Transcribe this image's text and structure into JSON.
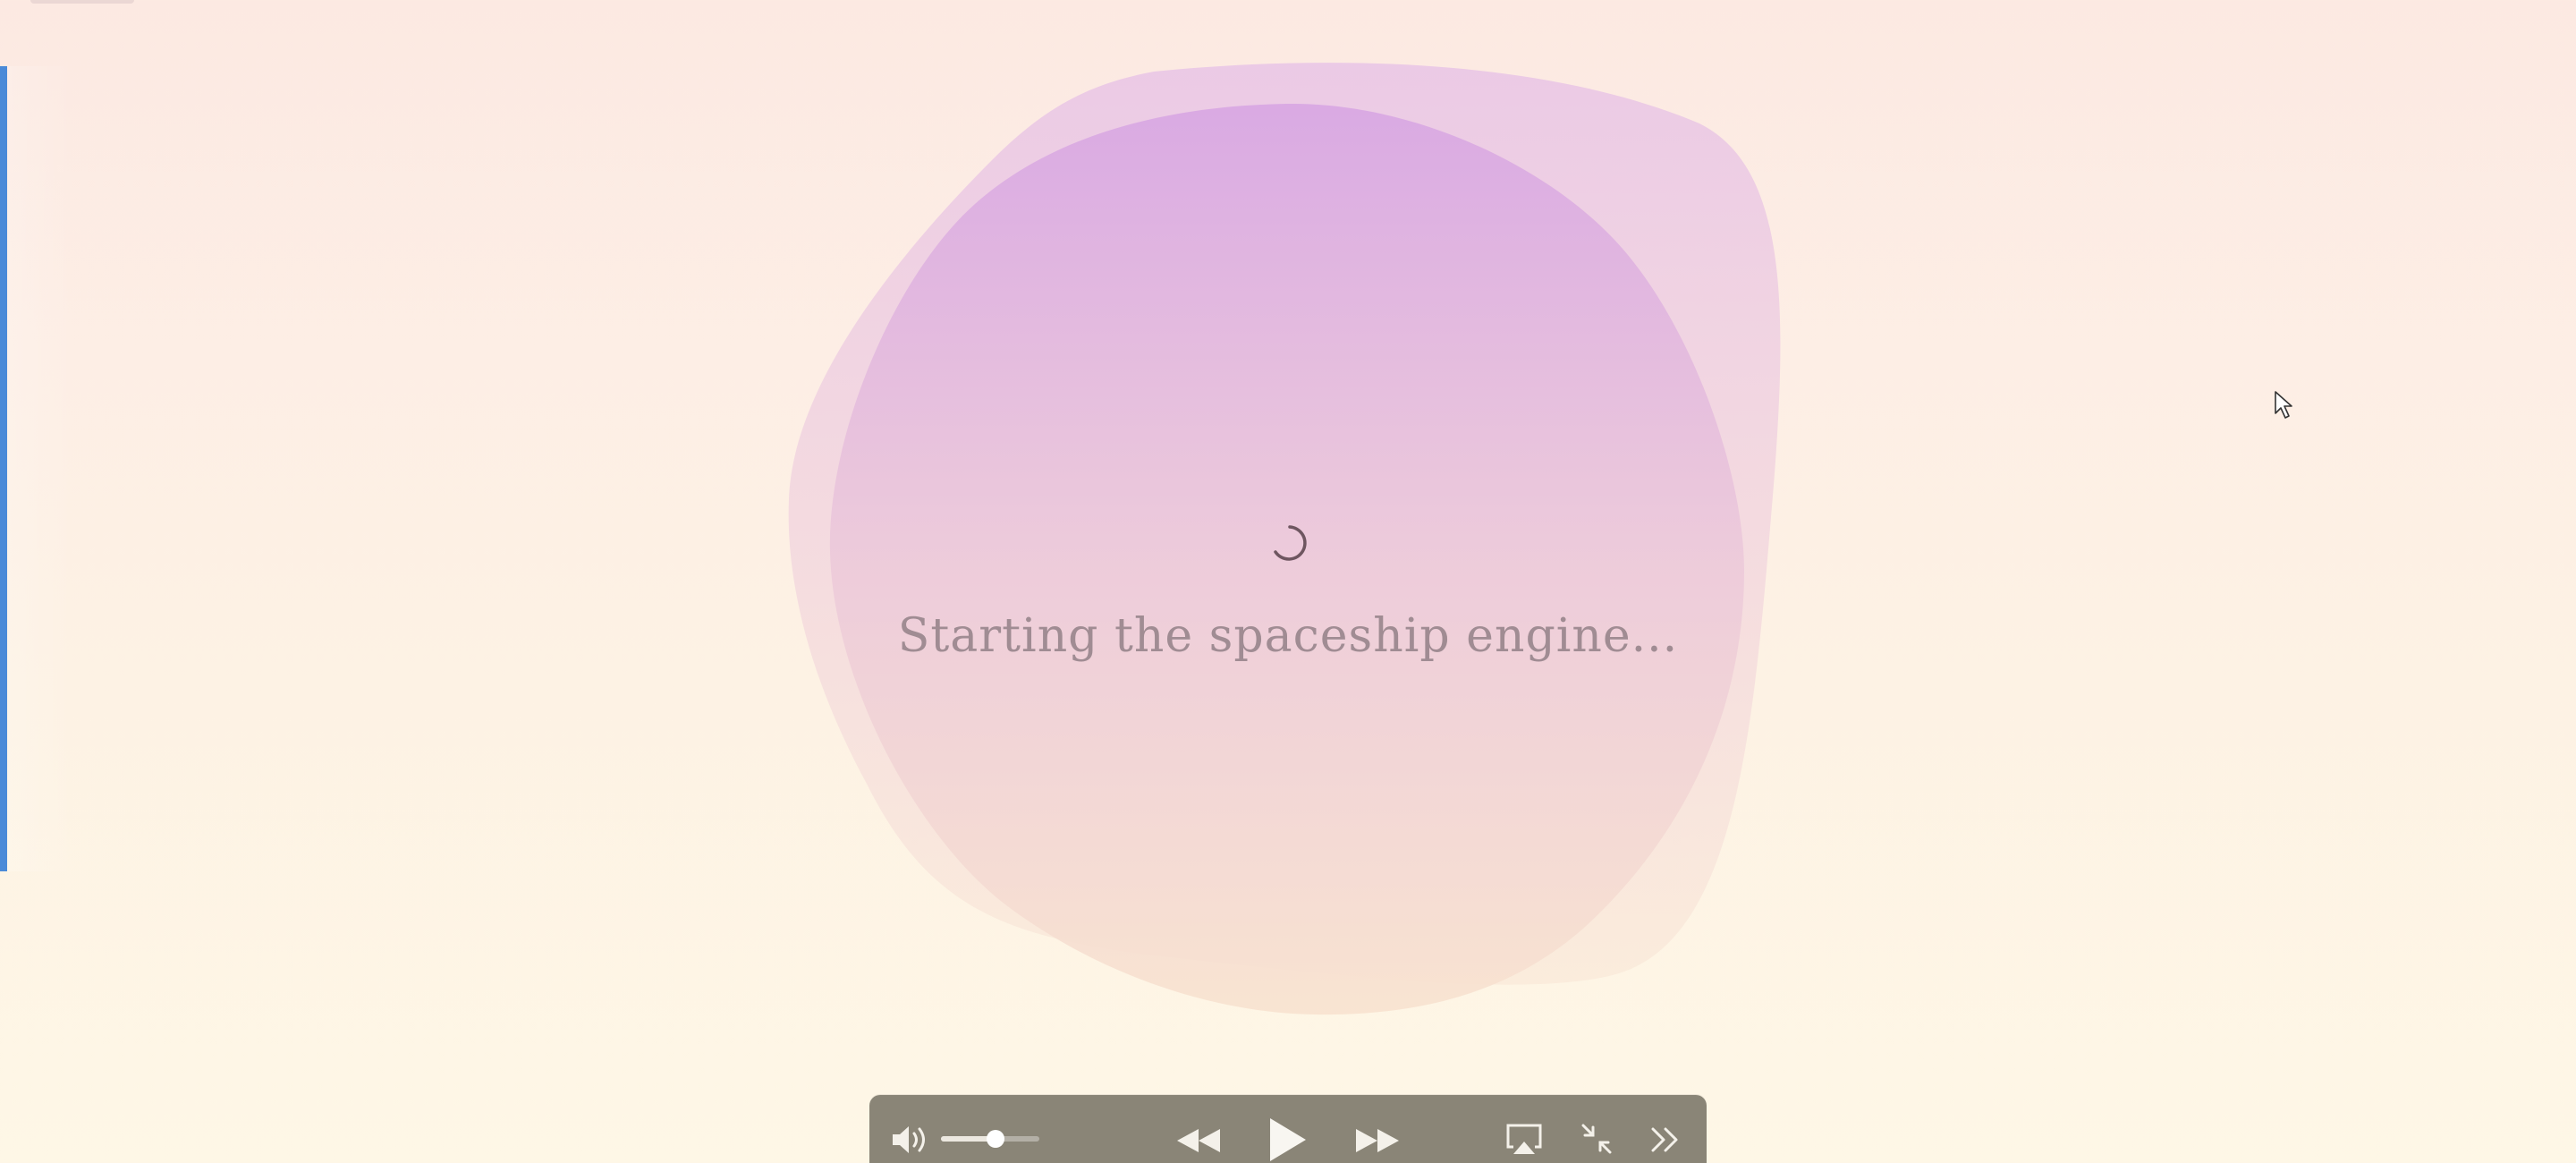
{
  "loader": {
    "message": "Starting the spaceship engine...",
    "spinner_icon": "loading-spinner-icon"
  },
  "colors": {
    "accent": "#4a8ad8",
    "blob_top": "#d9a8e4",
    "blob_bottom": "#f9e3cc",
    "text_muted": "#a08c93",
    "player_bar": "#8a8577"
  },
  "player": {
    "volume_icon": "speaker-volume-icon",
    "volume_level": 0.55,
    "rewind_icon": "rewind-icon",
    "play_icon": "play-icon",
    "fast_forward_icon": "fast-forward-icon",
    "airplay_icon": "airplay-icon",
    "exit_fullscreen_icon": "exit-fullscreen-icon",
    "more_icon": "chevron-double-right-icon"
  }
}
